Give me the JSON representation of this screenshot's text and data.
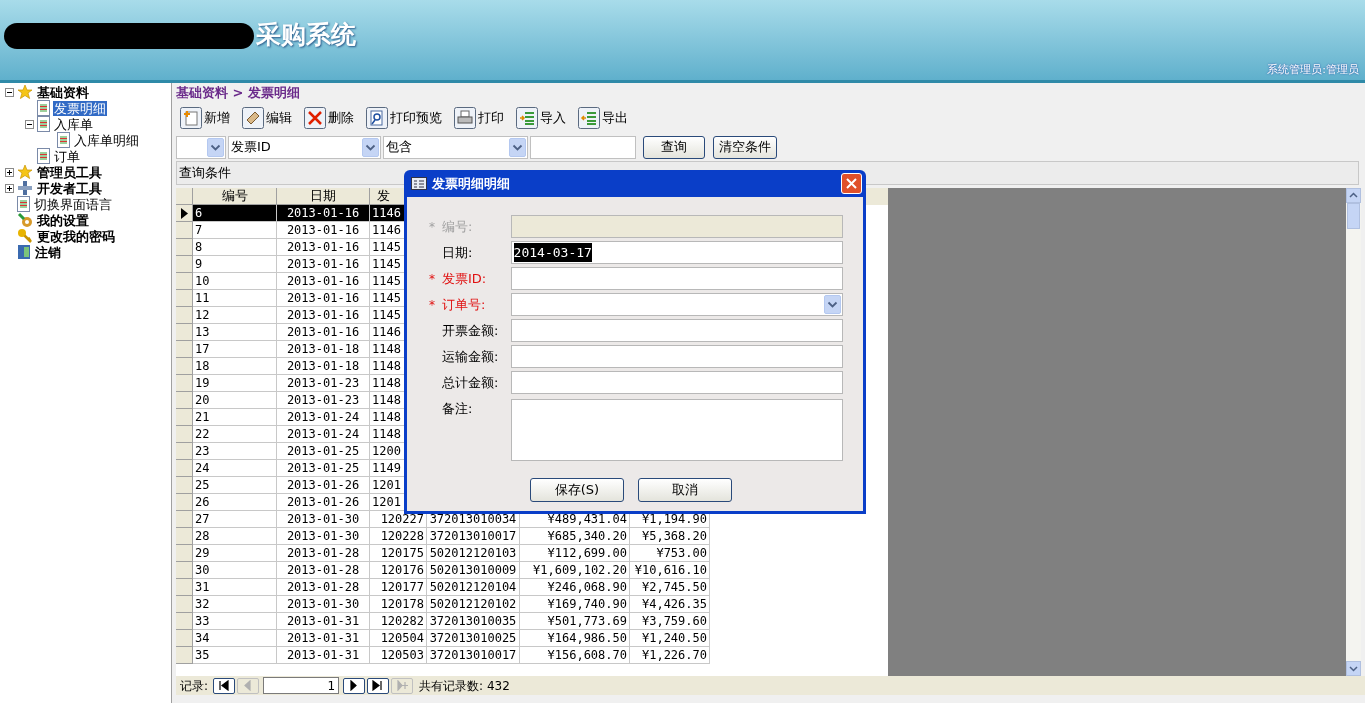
{
  "header": {
    "title": "采购系统",
    "user": "系统管理员:管理员"
  },
  "sidebar": {
    "items": [
      {
        "label": "基础资料",
        "kind": "star",
        "bold": true,
        "expanded": true,
        "selected": false,
        "children": [
          {
            "label": "发票明细",
            "kind": "page",
            "bold": false,
            "selected": true
          },
          {
            "label": "入库单",
            "kind": "page",
            "bold": false,
            "expanded": true,
            "selected": false,
            "children": [
              {
                "label": "入库单明细",
                "kind": "page",
                "bold": false,
                "selected": false
              }
            ]
          },
          {
            "label": "订单",
            "kind": "page",
            "bold": false,
            "selected": false
          }
        ]
      },
      {
        "label": "管理员工具",
        "kind": "star",
        "bold": true,
        "expanded": false,
        "selected": false
      },
      {
        "label": "开发者工具",
        "kind": "tools",
        "bold": true,
        "expanded": false,
        "selected": false
      },
      {
        "label": "切换界面语言",
        "kind": "page",
        "bold": false,
        "selected": false
      },
      {
        "label": "我的设置",
        "kind": "settings",
        "bold": true,
        "selected": false
      },
      {
        "label": "更改我的密码",
        "kind": "key",
        "bold": true,
        "selected": false
      },
      {
        "label": "注销",
        "kind": "exit",
        "bold": true,
        "selected": false
      }
    ]
  },
  "breadcrumb": "基础资料 > 发票明细",
  "toolbar": [
    {
      "label": "新增",
      "kind": "new"
    },
    {
      "label": "编辑",
      "kind": "edit"
    },
    {
      "label": "删除",
      "kind": "delete"
    },
    {
      "label": "打印预览",
      "kind": "preview"
    },
    {
      "label": "打印",
      "kind": "print"
    },
    {
      "label": "导入",
      "kind": "import"
    },
    {
      "label": "导出",
      "kind": "export"
    }
  ],
  "filter": {
    "selects": [
      {
        "value": "发票ID"
      },
      {
        "value": "包含"
      }
    ],
    "buttons": [
      "查询",
      "清空条件"
    ]
  },
  "query_panel": "查询条件",
  "table": {
    "columns": [
      "编号",
      "日期",
      "发"
    ],
    "rows": [
      {
        "cells": [
          "6",
          "2013-01-16",
          "1146"
        ],
        "selected": true
      },
      {
        "cells": [
          "7",
          "2013-01-16",
          "1146"
        ],
        "selected": false
      },
      {
        "cells": [
          "8",
          "2013-01-16",
          "1145"
        ],
        "selected": false
      },
      {
        "cells": [
          "9",
          "2013-01-16",
          "1145"
        ],
        "selected": false
      },
      {
        "cells": [
          "10",
          "2013-01-16",
          "1145"
        ],
        "selected": false
      },
      {
        "cells": [
          "11",
          "2013-01-16",
          "1145"
        ],
        "selected": false
      },
      {
        "cells": [
          "12",
          "2013-01-16",
          "1145"
        ],
        "selected": false
      },
      {
        "cells": [
          "13",
          "2013-01-16",
          "1146"
        ],
        "selected": false
      },
      {
        "cells": [
          "17",
          "2013-01-18",
          "1148"
        ],
        "selected": false
      },
      {
        "cells": [
          "18",
          "2013-01-18",
          "1148"
        ],
        "selected": false
      },
      {
        "cells": [
          "19",
          "2013-01-23",
          "1148"
        ],
        "selected": false
      },
      {
        "cells": [
          "20",
          "2013-01-23",
          "1148"
        ],
        "selected": false
      },
      {
        "cells": [
          "21",
          "2013-01-24",
          "1148"
        ],
        "selected": false
      },
      {
        "cells": [
          "22",
          "2013-01-24",
          "1148"
        ],
        "selected": false
      },
      {
        "cells": [
          "23",
          "2013-01-25",
          "1200"
        ],
        "selected": false
      },
      {
        "cells": [
          "24",
          "2013-01-25",
          "1149"
        ],
        "selected": false
      },
      {
        "cells": [
          "25",
          "2013-01-26",
          "1201"
        ],
        "selected": false
      },
      {
        "cells": [
          "26",
          "2013-01-26",
          "1201"
        ],
        "selected": false
      },
      {
        "cells": [
          "27",
          "2013-01-30",
          "120227",
          "372013010034",
          "¥489,431.04",
          "¥1,194.90"
        ],
        "selected": false
      },
      {
        "cells": [
          "28",
          "2013-01-30",
          "120228",
          "372013010017",
          "¥685,340.20",
          "¥5,368.20"
        ],
        "selected": false
      },
      {
        "cells": [
          "29",
          "2013-01-28",
          "120175",
          "502012120103",
          "¥112,699.00",
          "¥753.00"
        ],
        "selected": false
      },
      {
        "cells": [
          "30",
          "2013-01-28",
          "120176",
          "502013010009",
          "¥1,609,102.20",
          "¥10,616.10"
        ],
        "selected": false
      },
      {
        "cells": [
          "31",
          "2013-01-28",
          "120177",
          "502012120104",
          "¥246,068.90",
          "¥2,745.50"
        ],
        "selected": false
      },
      {
        "cells": [
          "32",
          "2013-01-30",
          "120178",
          "502012120102",
          "¥169,740.90",
          "¥4,426.35"
        ],
        "selected": false
      },
      {
        "cells": [
          "33",
          "2013-01-31",
          "120282",
          "372013010035",
          "¥501,773.69",
          "¥3,759.60"
        ],
        "selected": false
      },
      {
        "cells": [
          "34",
          "2013-01-31",
          "120504",
          "372013010025",
          "¥164,986.50",
          "¥1,240.50"
        ],
        "selected": false
      },
      {
        "cells": [
          "35",
          "2013-01-31",
          "120503",
          "372013010017",
          "¥156,608.70",
          "¥1,226.70"
        ],
        "selected": false
      }
    ]
  },
  "pager": {
    "label": "记录:",
    "page": "1",
    "total": "共有记录数: 432",
    "first_disabled": false,
    "prev_disabled": true,
    "next_disabled": false,
    "last_disabled": false,
    "new_disabled": true
  },
  "dialog": {
    "title": "发票明细明细",
    "fields": [
      {
        "marker": "*",
        "label": "编号:",
        "kind": "text",
        "disabled": true
      },
      {
        "label": "日期:",
        "kind": "text",
        "disabled": false,
        "value": "2014-03-17",
        "highlighted": true
      },
      {
        "marker": "*",
        "label": "发票ID:",
        "kind": "text",
        "disabled": false
      },
      {
        "marker": "*",
        "label": "订单号:",
        "kind": "combo",
        "disabled": false
      },
      {
        "label": "开票金额:",
        "kind": "text",
        "disabled": false
      },
      {
        "label": "运输金额:",
        "kind": "text",
        "disabled": false
      },
      {
        "label": "总计金额:",
        "kind": "text",
        "disabled": false
      },
      {
        "label": "备注:",
        "kind": "textarea",
        "disabled": false
      }
    ],
    "buttons": [
      "保存(S)",
      "取消"
    ]
  }
}
